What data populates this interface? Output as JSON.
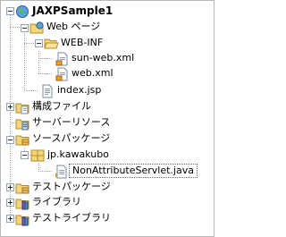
{
  "tree": {
    "project": "JAXPSample1",
    "web_pages": "Web ページ",
    "web_inf": "WEB-INF",
    "sun_web_xml": "sun-web.xml",
    "web_xml": "web.xml",
    "index_jsp": "index.jsp",
    "config_files": "構成ファイル",
    "server_resources": "サーバーリソース",
    "source_packages": "ソースパッケージ",
    "package_name": "jp.kawakubo",
    "servlet_file": "NonAttributeServlet.java",
    "test_packages": "テストパッケージ",
    "libraries": "ライブラリ",
    "test_libraries": "テストライブラリ"
  }
}
